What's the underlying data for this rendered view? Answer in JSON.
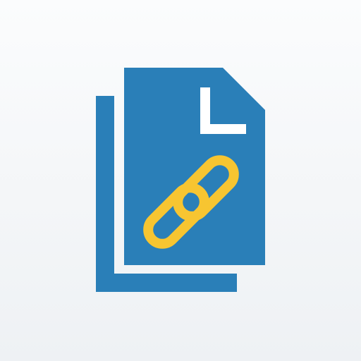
{
  "icon": {
    "name": "linked-documents-icon",
    "colors": {
      "background_top": "#fbfcfd",
      "background_bottom": "#eef1f4",
      "document": "#2a7fb8",
      "fold_mark": "#ffffff",
      "chain": "#f7c531"
    }
  }
}
